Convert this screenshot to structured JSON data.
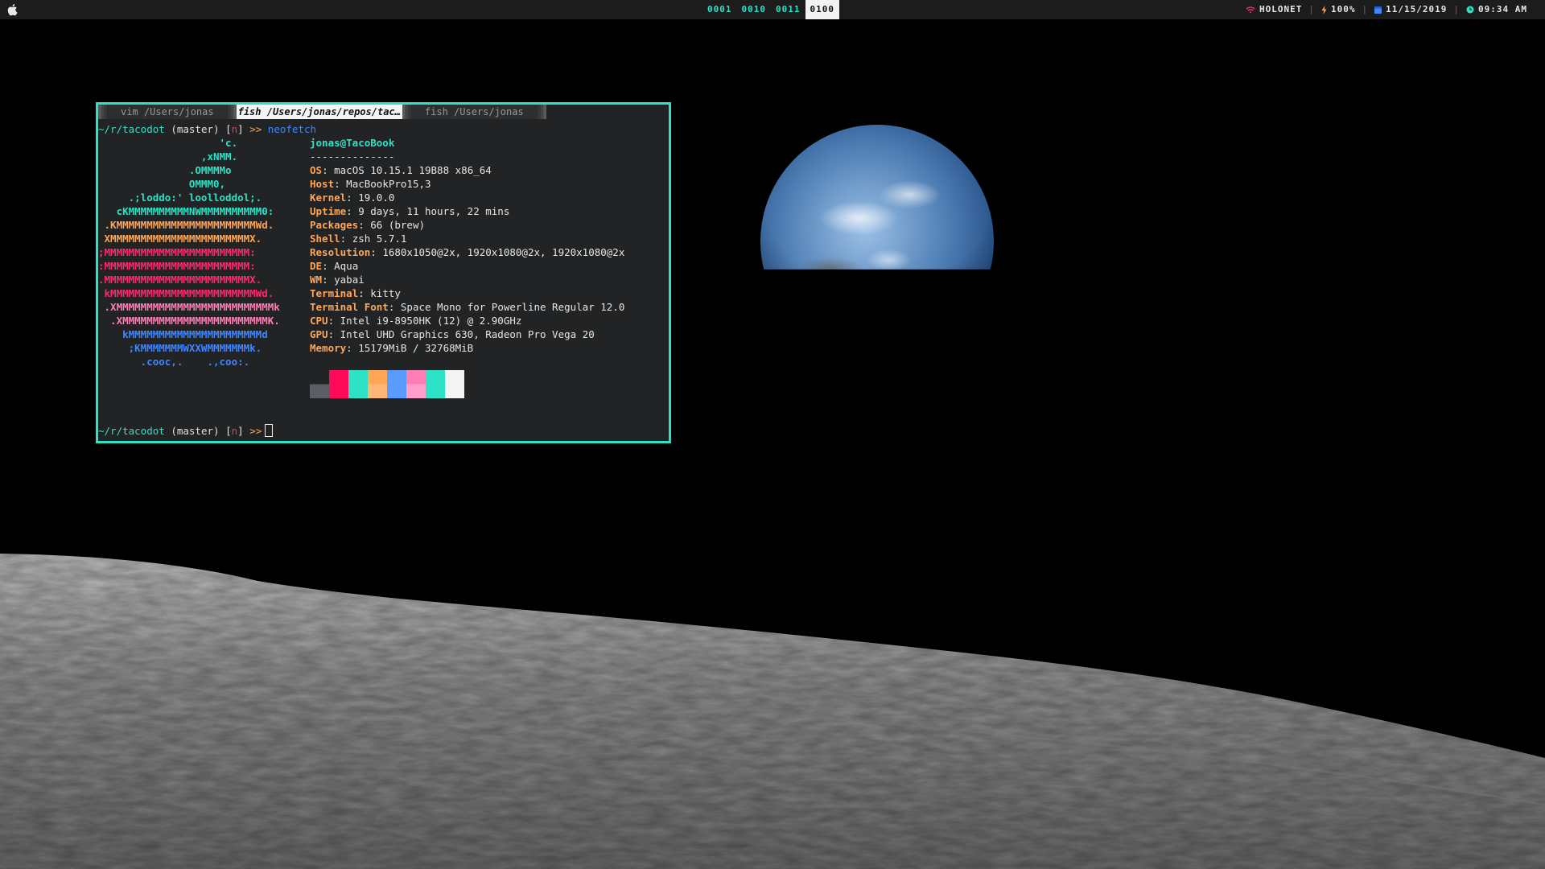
{
  "topbar": {
    "spaces": [
      "0001",
      "0010",
      "0011",
      "0100"
    ],
    "active_space": 3,
    "network": "HOLONET",
    "battery": "100%",
    "date": "11/15/2019",
    "time": "09:34 AM",
    "icons": [
      "apple-icon",
      "wifi-icon",
      "battery-icon",
      "calendar-icon",
      "clock-icon"
    ]
  },
  "terminal": {
    "tabs": [
      {
        "label": "vim /Users/jonas",
        "active": false
      },
      {
        "label": "fish /Users/jonas/repos/tac…",
        "active": true
      },
      {
        "label": "fish /Users/jonas",
        "active": false
      }
    ],
    "prompt": {
      "path": "~/r/tacodot",
      "branch": "(master)",
      "mode_open": "[",
      "mode": "n",
      "mode_close": "]",
      "symbol": ">>",
      "command": "neofetch"
    },
    "logo": [
      {
        "text": "                    'c.",
        "color": "#2de2c7"
      },
      {
        "text": "                 ,xNMM.",
        "color": "#2de2c7"
      },
      {
        "text": "               .OMMMMo",
        "color": "#2de2c7"
      },
      {
        "text": "               OMMM0,",
        "color": "#2de2c7"
      },
      {
        "text": "     .;loddo:' loolloddol;.",
        "color": "#2de2c7"
      },
      {
        "text": "   cKMMMMMMMMMMNWMMMMMMMMMM0:",
        "color": "#2de2c7"
      },
      {
        "text": " .KMMMMMMMMMMMMMMMMMMMMMMMWd.",
        "color": "#ffa657"
      },
      {
        "text": " XMMMMMMMMMMMMMMMMMMMMMMMX.",
        "color": "#ffa657"
      },
      {
        "text": ";MMMMMMMMMMMMMMMMMMMMMMMM:",
        "color": "#ff2a6d"
      },
      {
        "text": ":MMMMMMMMMMMMMMMMMMMMMMMM:",
        "color": "#ff2a6d"
      },
      {
        "text": ".MMMMMMMMMMMMMMMMMMMMMMMMX.",
        "color": "#ff2a6d"
      },
      {
        "text": " kMMMMMMMMMMMMMMMMMMMMMMMMWd.",
        "color": "#ff2a6d"
      },
      {
        "text": " .XMMMMMMMMMMMMMMMMMMMMMMMMMMk",
        "color": "#ff7eb6"
      },
      {
        "text": "  .XMMMMMMMMMMMMMMMMMMMMMMMMK.",
        "color": "#ff7eb6"
      },
      {
        "text": "    kMMMMMMMMMMMMMMMMMMMMMMd",
        "color": "#3f86ff"
      },
      {
        "text": "     ;KMMMMMMMWXXWMMMMMMMk.",
        "color": "#3f86ff"
      },
      {
        "text": "       .cooc,.    .,coo:.",
        "color": "#3f86ff"
      }
    ],
    "user_host": "jonas@TacoBook",
    "underline": "--------------",
    "info": [
      {
        "key": "OS",
        "value": "macOS 10.15.1 19B88 x86_64"
      },
      {
        "key": "Host",
        "value": "MacBookPro15,3"
      },
      {
        "key": "Kernel",
        "value": "19.0.0"
      },
      {
        "key": "Uptime",
        "value": "9 days, 11 hours, 22 mins"
      },
      {
        "key": "Packages",
        "value": "66 (brew)"
      },
      {
        "key": "Shell",
        "value": "zsh 5.7.1"
      },
      {
        "key": "Resolution",
        "value": "1680x1050@2x, 1920x1080@2x, 1920x1080@2x"
      },
      {
        "key": "DE",
        "value": "Aqua"
      },
      {
        "key": "WM",
        "value": "yabai"
      },
      {
        "key": "Terminal",
        "value": "kitty"
      },
      {
        "key": "Terminal Font",
        "value": "Space Mono for Powerline Regular 12.0"
      },
      {
        "key": "CPU",
        "value": "Intel i9-8950HK (12) @ 2.90GHz"
      },
      {
        "key": "GPU",
        "value": "Intel UHD Graphics 630, Radeon Pro Vega 20"
      },
      {
        "key": "Memory",
        "value": "15179MiB / 32768MiB"
      }
    ],
    "palette_top": [
      "#212325",
      "#ff0a5a",
      "#2de2c7",
      "#ffa657",
      "#5a9bff",
      "#ff7eb6",
      "#2de2c7",
      "#f4f4f4"
    ],
    "palette_bottom": [
      "#5a5e66",
      "#ff0a5a",
      "#2de2c7",
      "#ffb877",
      "#5a9bff",
      "#ff9ecb",
      "#2de2c7",
      "#f4f4f4"
    ]
  },
  "colors": {
    "accent": "#2de2c7",
    "red": "#ff2a6d",
    "orange": "#ffa657",
    "blue": "#3f86ff"
  }
}
